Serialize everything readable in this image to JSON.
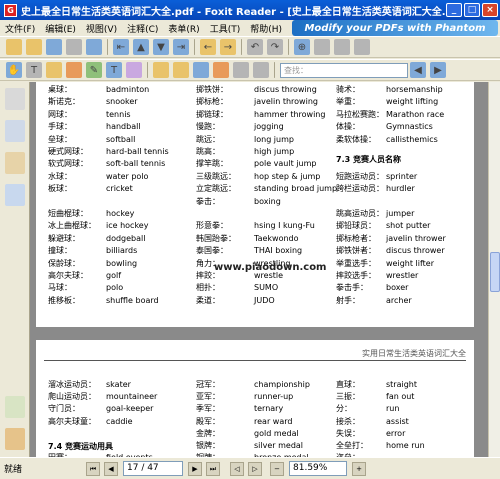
{
  "window": {
    "title": "史上最全日常生活类英语词汇大全.pdf - Foxit Reader - [史上最全日常生活类英语词汇大全..."
  },
  "menu": [
    "文件(F)",
    "编辑(E)",
    "视图(V)",
    "注释(C)",
    "表单(R)",
    "工具(T)",
    "帮助(H)"
  ],
  "banner": {
    "text": "Modify your PDFs with Phantom"
  },
  "find": {
    "placeholder": "查找："
  },
  "watermark": "www.piaodown.com",
  "page1": {
    "rows": [
      [
        "桌球：",
        "badminton",
        "掷铁饼：",
        "discus throwing",
        "骑术：",
        "horsemanship"
      ],
      [
        "斯诺克：",
        "snooker",
        "掷标枪：",
        "javelin throwing",
        "举重：",
        "weight lifting"
      ],
      [
        "网球：",
        "tennis",
        "掷链球：",
        "hammer throwing",
        "马拉松赛跑：",
        "Marathon race"
      ],
      [
        "手球：",
        "handball",
        "慢跑：",
        "jogging",
        "体操：",
        "Gymnastics"
      ],
      [
        "垒球：",
        "softball",
        "跳远：",
        "long jump",
        "柔软体操：",
        "callisthemics"
      ],
      [
        "硬式网球：",
        "hard-ball tennis",
        "跳高：",
        "high jump",
        "",
        ""
      ],
      [
        "软式网球：",
        "soft-ball tennis",
        "撑竿跳：",
        "pole vault jump",
        "",
        ""
      ],
      [
        "水球：",
        "water polo",
        "三级跳远：",
        "hop step & jump",
        "短跑运动员：",
        "sprinter"
      ],
      [
        "板球：",
        "cricket",
        "立定跳远：",
        "standing broad jump",
        "跨栏运动员：",
        "hurdler"
      ],
      [
        "短曲棍球：",
        "hockey",
        "",
        "",
        "跳高运动员：",
        "jumper"
      ],
      [
        "冰上曲棍球：",
        "ice hockey",
        "形意拳：",
        "hsing I kung-Fu",
        "掷铅球员：",
        "shot putter"
      ],
      [
        "躲避球：",
        "dodgeball",
        "韩国跆拳：",
        "Taekwondo",
        "掷标枪者：",
        "javelin thrower"
      ],
      [
        "撞球：",
        "billiards",
        "泰国拳：",
        "THAI boxing",
        "掷铁饼者：",
        "discus thrower"
      ],
      [
        "保龄球：",
        "bowling",
        "角力：",
        "wrestling",
        "举重选手：",
        "weight lifter"
      ],
      [
        "高尔夫球：",
        "golf",
        "摔跤：",
        "wrestle",
        "摔跤选手：",
        "wrestler"
      ],
      [
        "马球：",
        "polo",
        "相扑：",
        "SUMO",
        "拳击手：",
        "boxer"
      ],
      [
        "推移板：",
        "shuffle board",
        "柔道：",
        "JUDO",
        "射手：",
        "archer"
      ]
    ],
    "boxing_row": [
      "拳击：",
      "boxing"
    ],
    "heading": "7.3 竞赛人员名称",
    "page_number": "17 / 47"
  },
  "page2": {
    "header": "实用日常生活类英语词汇大全",
    "rows": [
      [
        "溜冰运动员：",
        "skater",
        "冠军：",
        "championship",
        "直球：",
        "straight"
      ],
      [
        "爬山运动员：",
        "mountaineer",
        "亚军：",
        "runner-up",
        "三振：",
        "fan out"
      ],
      [
        "守门员：",
        "goal-keeper",
        "季军：",
        "ternary",
        "分：",
        "run"
      ],
      [
        "高尔夫球童：",
        "caddie",
        "殿军：",
        "rear ward",
        "接杀：",
        "assist"
      ],
      [
        "",
        "",
        "金牌：",
        "gold medal",
        "失误：",
        "error"
      ],
      [
        "",
        "",
        "银牌：",
        "silver medal",
        "全垒打：",
        "home run"
      ],
      [
        "田赛：",
        "field events",
        "铜牌：",
        "bronze medal",
        "盗垒：",
        ""
      ]
    ],
    "heading": "7.4 竞赛运动用具"
  },
  "status": {
    "left": "就绪",
    "page_field": "17 / 47",
    "zoom": "81.59%"
  }
}
